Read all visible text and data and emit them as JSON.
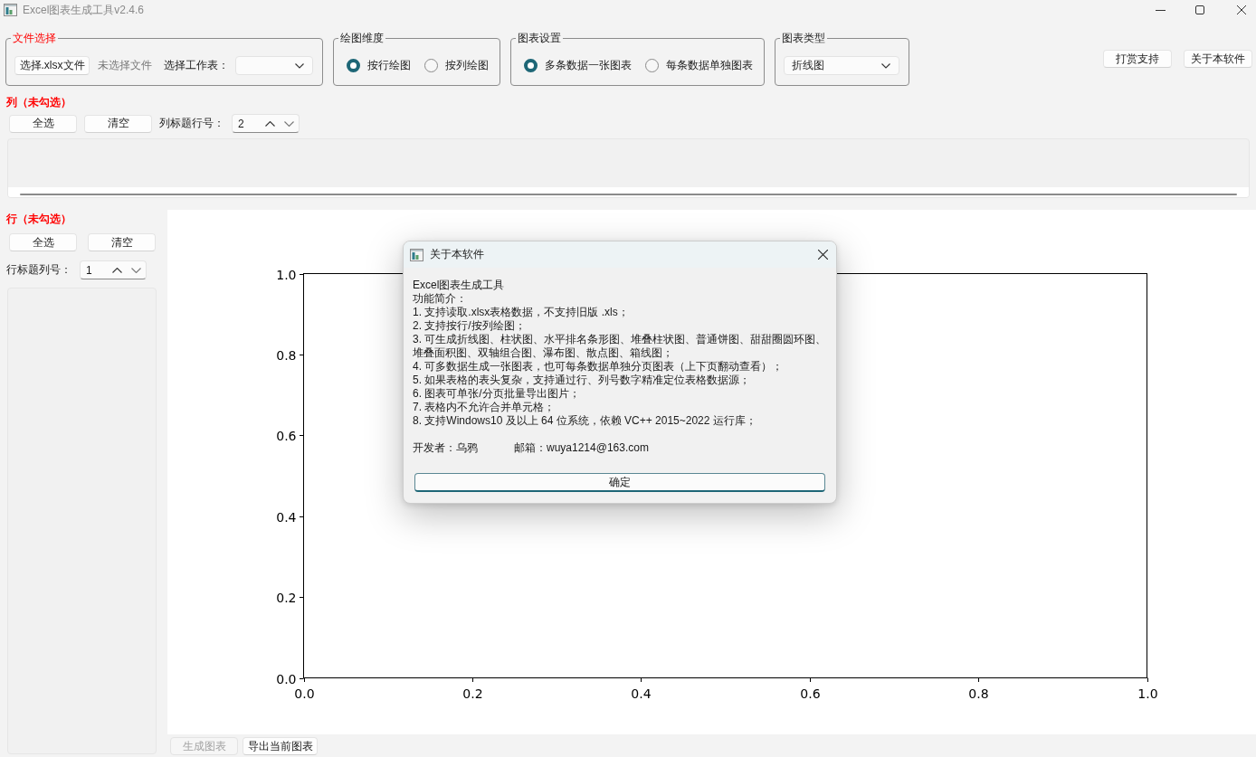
{
  "window": {
    "title": "Excel图表生成工具v2.4.6"
  },
  "file_group": {
    "title": "文件选择",
    "open_button": "选择.xlsx文件",
    "file_status": "未选择文件",
    "sheet_label": "选择工作表："
  },
  "dimension_group": {
    "title": "绘图维度",
    "options": [
      {
        "label": "按行绘图",
        "selected": true
      },
      {
        "label": "按列绘图",
        "selected": false
      }
    ]
  },
  "chart_settings_group": {
    "title": "图表设置",
    "options": [
      {
        "label": "多条数据一张图表",
        "selected": true
      },
      {
        "label": "每条数据单独图表",
        "selected": false
      }
    ]
  },
  "chart_type_group": {
    "title": "图表类型",
    "combo_value": "折线图"
  },
  "header_buttons": [
    "打赏支持",
    "关于本软件"
  ],
  "columns_section": {
    "title": "列（未勾选）",
    "buttons": [
      "全选",
      "清空"
    ],
    "header_label": "列标题行号：",
    "header_value": "2"
  },
  "rows_section": {
    "title": "行（未勾选）",
    "buttons": [
      "全选",
      "清空"
    ],
    "header_label": "行标题列号：",
    "header_value": "1"
  },
  "chart": {
    "chart_data": {
      "type": "line",
      "xlim": [
        0,
        1
      ],
      "ylim": [
        0,
        1
      ],
      "xticks": [
        {
          "value": 0,
          "label": "0.0"
        },
        {
          "value": 0.2,
          "label": "0.2"
        },
        {
          "value": 0.4,
          "label": "0.4"
        },
        {
          "value": 0.6,
          "label": "0.6"
        },
        {
          "value": 0.8,
          "label": "0.8"
        },
        {
          "value": 1,
          "label": "1.0"
        }
      ],
      "yticks": [
        {
          "value": 0,
          "label": "0.0"
        },
        {
          "value": 0.2,
          "label": "0.2"
        },
        {
          "value": 0.4,
          "label": "0.4"
        },
        {
          "value": 0.6,
          "label": "0.6"
        },
        {
          "value": 0.8,
          "label": "0.8"
        },
        {
          "value": 1,
          "label": "1.0"
        }
      ]
    }
  },
  "bottom_buttons": [
    {
      "label": "生成图表",
      "disabled": true
    },
    {
      "label": "导出当前图表",
      "disabled": false
    }
  ],
  "dialog": {
    "title": "关于本软件",
    "lines": [
      "Excel图表生成工具",
      "功能简介：",
      "1. 支持读取.xlsx表格数据，不支持旧版 .xls；",
      "2. 支持按行/按列绘图；",
      "3. 可生成折线图、柱状图、水平排名条形图、堆叠柱状图、普通饼图、甜甜圈圆环图、堆叠面积图、双轴组合图、瀑布图、散点图、箱线图；",
      "4. 可多数据生成一张图表，也可每条数据单独分页图表（上下页翻动查看）；",
      "5. 如果表格的表头复杂，支持通过行、列号数字精准定位表格数据源；",
      "6. 图表可单张/分页批量导出图片；",
      "7. 表格内不允许合并单元格；",
      "8. 支持Windows10 及以上 64 位系统，依赖 VC++ 2015~2022 运行库；"
    ],
    "developer": "开发者：乌鸦",
    "email": "邮箱：wuya1214@163.com",
    "button": "确定"
  }
}
